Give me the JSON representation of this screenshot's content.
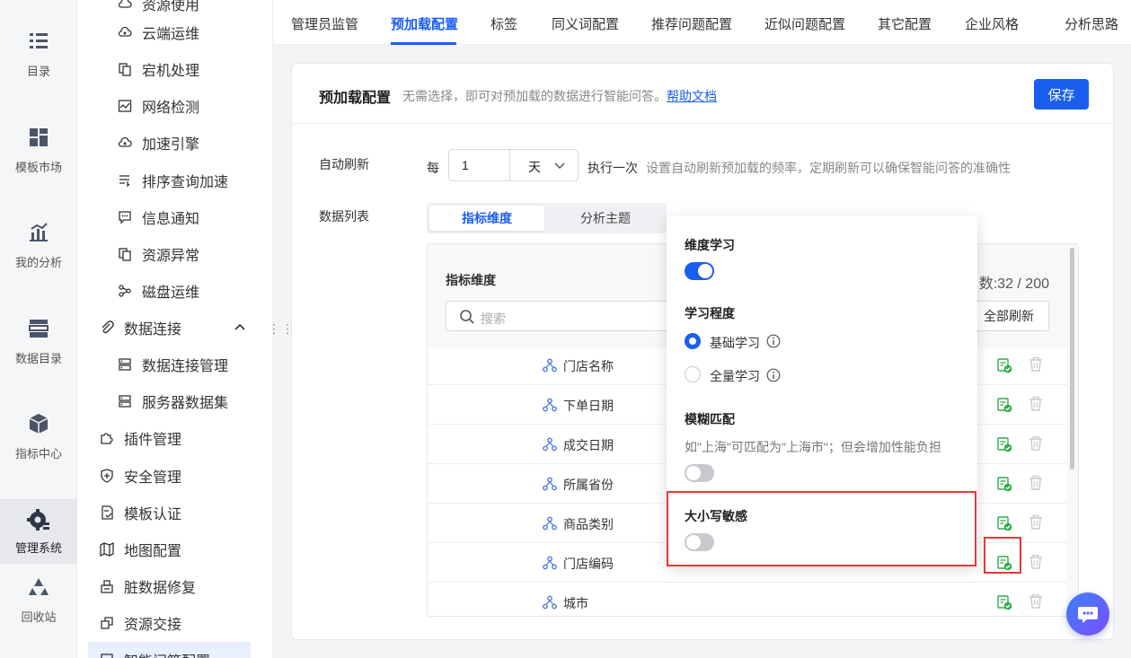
{
  "leftbar": {
    "items": [
      {
        "label": "目录",
        "icon": "list-icon"
      },
      {
        "label": "模板市场",
        "icon": "grid-icon"
      },
      {
        "label": "我的分析",
        "icon": "chart-icon"
      },
      {
        "label": "数据目录",
        "icon": "table-icon"
      },
      {
        "label": "指标中心",
        "icon": "cube-icon"
      },
      {
        "label": "管理系统",
        "icon": "gear-icon"
      },
      {
        "label": "回收站",
        "icon": "recycle-icon"
      }
    ]
  },
  "sidebar": {
    "items": [
      {
        "label": "资源使用"
      },
      {
        "label": "云端运维"
      },
      {
        "label": "宕机处理"
      },
      {
        "label": "网络检测"
      },
      {
        "label": "加速引擎"
      },
      {
        "label": "排序查询加速"
      },
      {
        "label": "信息通知"
      },
      {
        "label": "资源异常"
      },
      {
        "label": "磁盘运维"
      },
      {
        "label": "数据连接"
      },
      {
        "label": "数据连接管理"
      },
      {
        "label": "服务器数据集"
      },
      {
        "label": "插件管理"
      },
      {
        "label": "安全管理"
      },
      {
        "label": "模板认证"
      },
      {
        "label": "地图配置"
      },
      {
        "label": "脏数据修复"
      },
      {
        "label": "资源交接"
      },
      {
        "label": "智能问答配置"
      }
    ]
  },
  "tabs": [
    "管理员监管",
    "预加载配置",
    "标签",
    "同义词配置",
    "推荐问题配置",
    "近似问题配置",
    "其它配置",
    "企业风格",
    "分析思路"
  ],
  "card": {
    "title": "预加载配置",
    "desc": "无需选择，即可对预加载的数据进行智能问答。",
    "help_link": "帮助文档",
    "save_label": "保存"
  },
  "auto_refresh": {
    "label": "自动刷新",
    "prefix": "每",
    "value": "1",
    "unit": "天",
    "suffix": "执行一次",
    "hint": "设置自动刷新预加载的频率，定期刷新可以确保智能问答的准确性"
  },
  "data_list": {
    "label": "数据列表",
    "seg_tabs": [
      "指标维度",
      "分析主题"
    ],
    "list_title": "指标维度",
    "count_text": "数:32 / 200",
    "search_placeholder": "搜索",
    "refresh_all": "全部刷新",
    "rows": [
      "门店名称",
      "下单日期",
      "成交日期",
      "所属省份",
      "商品类别",
      "门店编码",
      "城市"
    ]
  },
  "popover": {
    "dim_learning": "维度学习",
    "dim_learning_on": true,
    "learning_level": "学习程度",
    "level_options": [
      "基础学习",
      "全量学习"
    ],
    "level_selected": "基础学习",
    "fuzzy_match": "模糊匹配",
    "fuzzy_desc": "如\"上海\"可匹配为\"上海市\"；但会增加性能负担",
    "fuzzy_on": false,
    "case_sensitive": "大小写敏感",
    "case_on": false
  },
  "colors": {
    "accent": "#1a5ef0",
    "highlight": "#e53935",
    "refresh_icon": "#2eaa4a"
  }
}
